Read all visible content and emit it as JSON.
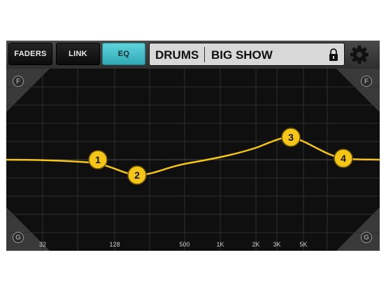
{
  "toolbar": {
    "buttons": [
      {
        "label": "FADERS",
        "active": false
      },
      {
        "label": "LINK",
        "active": false
      },
      {
        "label": "EQ",
        "active": true
      }
    ],
    "channel_name": "DRUMS",
    "scene_name": "BIG SHOW",
    "lock_icon": "lock-icon",
    "settings_icon": "gear-icon"
  },
  "graph": {
    "corner_labels": {
      "top_left": "F",
      "top_right": "F",
      "bottom_left": "G",
      "bottom_right": "G"
    },
    "freq_labels": [
      "32",
      "128",
      "500",
      "1K",
      "2K",
      "3K",
      "5K"
    ],
    "bands": [
      {
        "label": "1"
      },
      {
        "label": "2"
      },
      {
        "label": "3"
      },
      {
        "label": "4"
      }
    ]
  },
  "colors": {
    "accent": "#46c2cc",
    "curve": "#f5c518",
    "node_fill": "#f5c518",
    "background": "#0f0f0f",
    "grid": "#333333"
  }
}
